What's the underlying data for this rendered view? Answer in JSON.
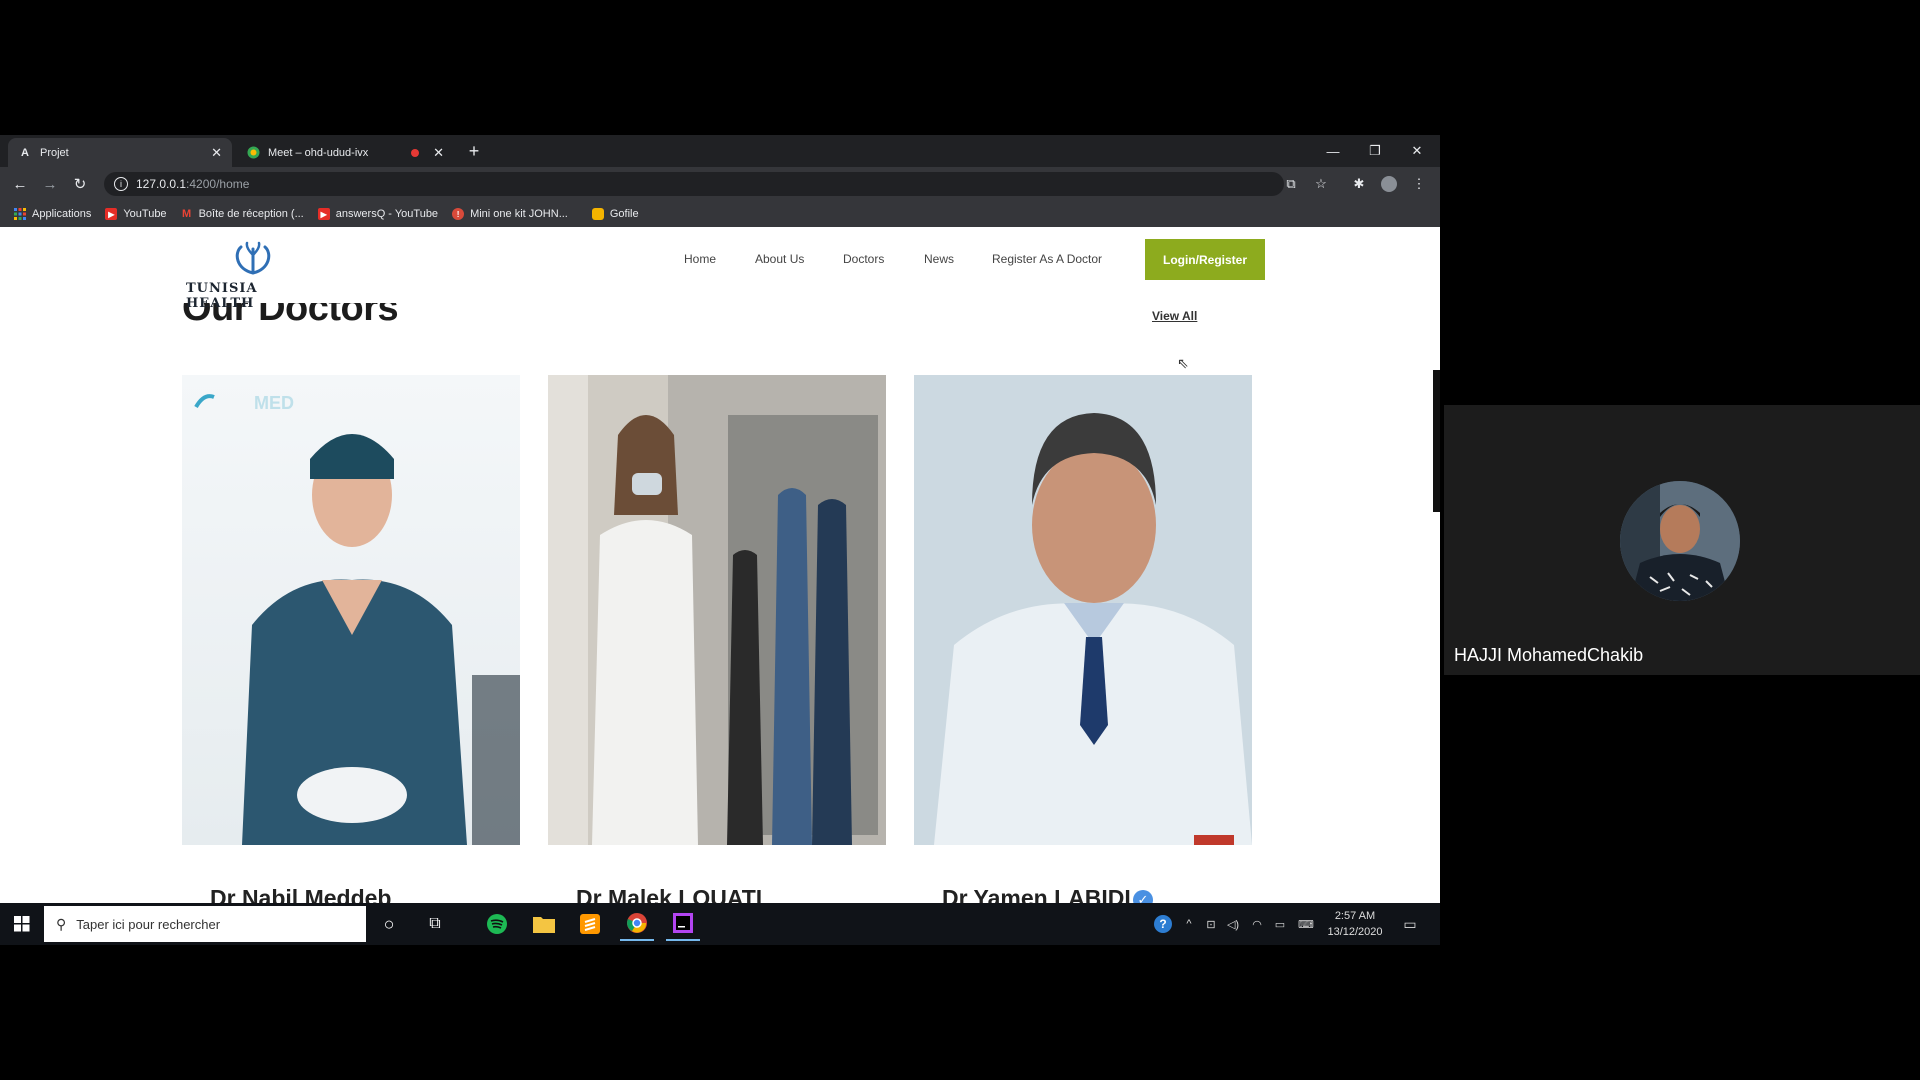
{
  "browser": {
    "tabs": [
      {
        "title": "Projet",
        "active": true
      },
      {
        "title": "Meet – ohd-udud-ivx",
        "active": false
      }
    ],
    "url": {
      "host": "127.0.0.1",
      "path": ":4200/home"
    },
    "bookmarks": [
      {
        "label": "Applications",
        "icon": "apps-icon"
      },
      {
        "label": "YouTube",
        "icon": "youtube-icon"
      },
      {
        "label": "Boîte de réception (...",
        "icon": "gmail-icon"
      },
      {
        "label": "answersQ - YouTube",
        "icon": "youtube-icon"
      },
      {
        "label": "Mini one kit JOHN...",
        "icon": "bookmark-icon"
      },
      {
        "label": "Gofile",
        "icon": "gofile-icon"
      }
    ]
  },
  "site": {
    "logo_text": "TUNISIA HEALTH",
    "nav": [
      "Home",
      "About Us",
      "Doctors",
      "News",
      "Register As A Doctor"
    ],
    "login_button": "Login/Register",
    "section_title": "Our Doctors",
    "view_all": "View All",
    "doctors": [
      {
        "name": "Dr Nabil Meddeb",
        "verified": false
      },
      {
        "name": "Dr Malek LOUATI",
        "verified": false
      },
      {
        "name": "Dr Yamen LABIDI",
        "verified": true
      }
    ],
    "watermark_text": "MED",
    "accent_color": "#8dab1e"
  },
  "taskbar": {
    "search_placeholder": "Taper ici pour rechercher",
    "time": "2:57 AM",
    "date": "13/12/2020"
  },
  "meeting": {
    "participant_name": "HAJJI MohamedChakib"
  }
}
